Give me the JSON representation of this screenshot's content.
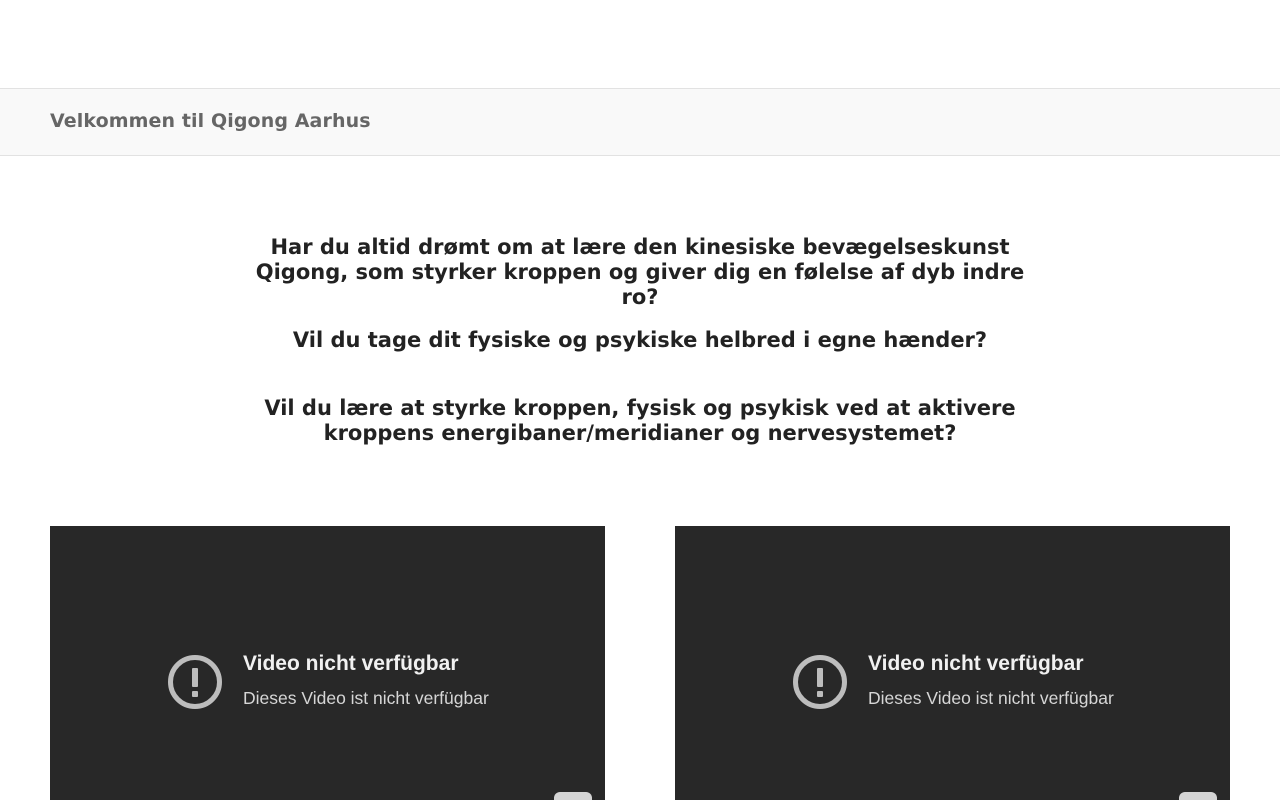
{
  "header": {
    "page_title": "Velkommen til Qigong Aarhus"
  },
  "intro": {
    "paragraph_1": "Har du altid drømt om at lære den kinesiske bevægelseskunst Qigong, som styrker kroppen og giver dig en følelse af dyb indre ro?",
    "paragraph_2": "Vil du tage dit fysiske og psykiske helbred i egne hænder?",
    "paragraph_3": "Vil du lære at styrke kroppen, fysisk og psykisk ved at aktivere kroppens energibaner/meridianer og nervesystemet?"
  },
  "videos": [
    {
      "heading": "Video nicht verfügbar",
      "message": "Dieses Video ist nicht verfügbar",
      "icon": "alert-circle-icon"
    },
    {
      "heading": "Video nicht verfügbar",
      "message": "Dieses Video ist nicht verfügbar",
      "icon": "alert-circle-icon"
    }
  ],
  "colors": {
    "page_background": "#ffffff",
    "title_bar_background": "#f9f9f9",
    "title_text": "#666666",
    "body_text": "#222222",
    "video_background": "#282828",
    "icon_color": "#bdbdbd"
  }
}
